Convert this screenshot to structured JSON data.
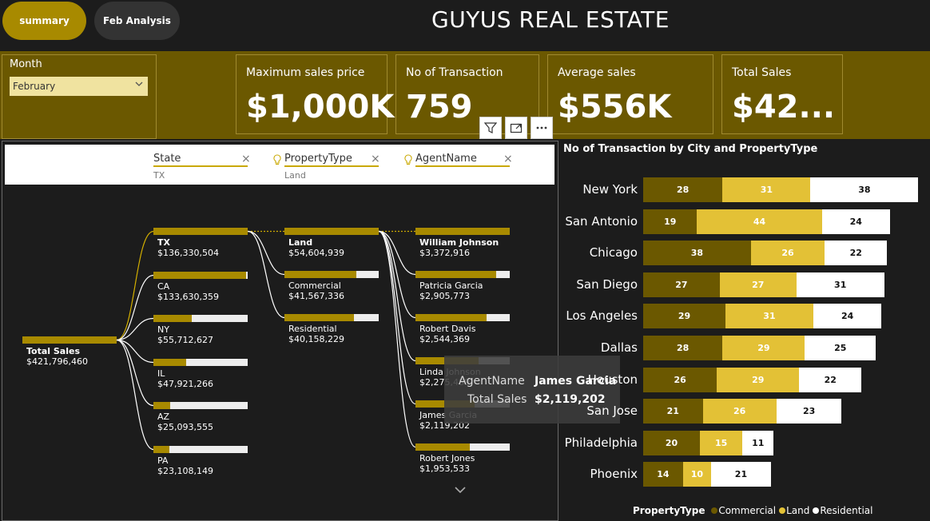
{
  "tabs": [
    {
      "label": "summary"
    },
    {
      "label": "Feb Analysis"
    }
  ],
  "title": "GUYUS REAL ESTATE",
  "month": {
    "label": "Month",
    "value": "February"
  },
  "kpis": [
    {
      "label": "Maximum sales price",
      "value": "$1,000K"
    },
    {
      "label": "No of Transaction",
      "value": "759"
    },
    {
      "label": "Average sales",
      "value": "$556K"
    },
    {
      "label": "Total Sales",
      "value": "$42..."
    }
  ],
  "filters": [
    {
      "field": "State",
      "value": "TX"
    },
    {
      "field": "PropertyType",
      "value": "Land"
    },
    {
      "field": "AgentName",
      "value": ""
    }
  ],
  "tree": {
    "root": {
      "label": "Total Sales",
      "value": "$421,796,460",
      "fill": 1.0
    },
    "state": [
      {
        "label": "TX",
        "value": "$136,330,504",
        "fill": 1.0
      },
      {
        "label": "CA",
        "value": "$133,630,359",
        "fill": 0.98
      },
      {
        "label": "NY",
        "value": "$55,712,627",
        "fill": 0.41
      },
      {
        "label": "IL",
        "value": "$47,921,266",
        "fill": 0.35
      },
      {
        "label": "AZ",
        "value": "$25,093,555",
        "fill": 0.18
      },
      {
        "label": "PA",
        "value": "$23,108,149",
        "fill": 0.17
      }
    ],
    "property": [
      {
        "label": "Land",
        "value": "$54,604,939",
        "fill": 1.0
      },
      {
        "label": "Commercial",
        "value": "$41,567,336",
        "fill": 0.76
      },
      {
        "label": "Residential",
        "value": "$40,158,229",
        "fill": 0.74
      }
    ],
    "agent": [
      {
        "label": "William Johnson",
        "value": "$3,372,916",
        "fill": 1.0
      },
      {
        "label": "Patricia Garcia",
        "value": "$2,905,773",
        "fill": 0.86
      },
      {
        "label": "Robert Davis",
        "value": "$2,544,369",
        "fill": 0.75
      },
      {
        "label": "Linda Johnson",
        "value": "$2,275,489",
        "fill": 0.67
      },
      {
        "label": "James Garcia",
        "value": "$2,119,202",
        "fill": 0.63
      },
      {
        "label": "Robert Jones",
        "value": "$1,953,533",
        "fill": 0.58
      }
    ]
  },
  "tooltip": {
    "k1": "AgentName",
    "v1": "James Garcia",
    "k2": "Total Sales",
    "v2": "$2,119,202"
  },
  "chart_data": {
    "type": "bar",
    "title": "No of Transaction by City and PropertyType",
    "categories": [
      "New York",
      "San Antonio",
      "Chicago",
      "San Diego",
      "Los Angeles",
      "Dallas",
      "Houston",
      "San Jose",
      "Philadelphia",
      "Phoenix"
    ],
    "series": [
      {
        "name": "Commercial",
        "color": "#6b5800",
        "values": [
          28,
          19,
          38,
          27,
          29,
          28,
          26,
          21,
          20,
          14
        ]
      },
      {
        "name": "Land",
        "color": "#e3c136",
        "values": [
          31,
          44,
          26,
          27,
          31,
          29,
          29,
          26,
          15,
          10
        ]
      },
      {
        "name": "Residential",
        "color": "#ffffff",
        "values": [
          38,
          24,
          22,
          31,
          24,
          25,
          22,
          23,
          11,
          21
        ]
      }
    ],
    "legend_title": "PropertyType",
    "legend_position": "bottom"
  }
}
